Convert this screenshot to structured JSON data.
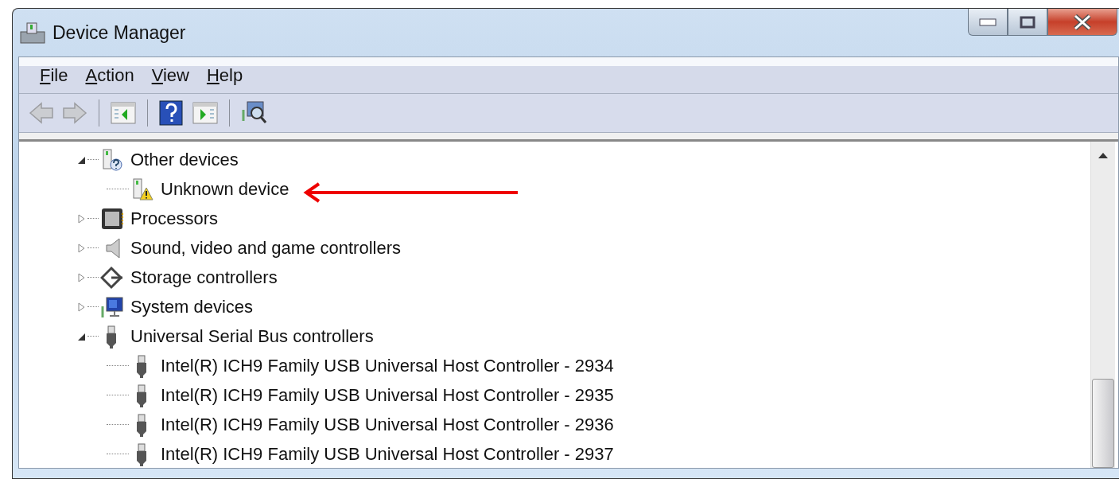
{
  "window": {
    "title": "Device Manager"
  },
  "menu": [
    {
      "label": "File"
    },
    {
      "label": "Action"
    },
    {
      "label": "View"
    },
    {
      "label": "Help"
    }
  ],
  "toolbar": [
    {
      "kind": "back",
      "disabled": true
    },
    {
      "kind": "forward",
      "disabled": true
    },
    {
      "kind": "separator"
    },
    {
      "kind": "tree-pane"
    },
    {
      "kind": "separator"
    },
    {
      "kind": "help"
    },
    {
      "kind": "action-pane"
    },
    {
      "kind": "separator"
    },
    {
      "kind": "scan"
    }
  ],
  "tree": [
    {
      "label": "Other devices",
      "kind": "unknown",
      "expanded": true,
      "children": [
        {
          "label": "Unknown device",
          "kind": "warning"
        }
      ]
    },
    {
      "label": "Processors",
      "kind": "processor",
      "expanded": false
    },
    {
      "label": "Sound, video and game controllers",
      "kind": "sound",
      "expanded": false
    },
    {
      "label": "Storage controllers",
      "kind": "storage",
      "expanded": false
    },
    {
      "label": "System devices",
      "kind": "system",
      "expanded": false
    },
    {
      "label": "Universal Serial Bus controllers",
      "kind": "usb",
      "expanded": true,
      "children": [
        {
          "label": "Intel(R) ICH9 Family USB Universal Host Controller - 2934",
          "kind": "usb"
        },
        {
          "label": "Intel(R) ICH9 Family USB Universal Host Controller - 2935",
          "kind": "usb"
        },
        {
          "label": "Intel(R) ICH9 Family USB Universal Host Controller - 2936",
          "kind": "usb"
        },
        {
          "label": "Intel(R) ICH9 Family USB Universal Host Controller - 2937",
          "kind": "usb"
        }
      ]
    }
  ]
}
